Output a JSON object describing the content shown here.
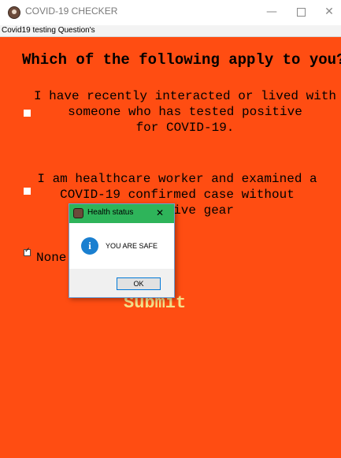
{
  "window": {
    "title": "COVID-19 CHECKER",
    "menu_label": "Covid19 testing Question's",
    "minimize": "—",
    "close": "✕"
  },
  "form": {
    "heading": "Which of the following apply to you?",
    "options": [
      {
        "text": "I have recently interacted or lived with\nsomeone who has tested positive\nfor COVID-19.",
        "checked": false
      },
      {
        "text": "I am healthcare worker and examined a\nCOVID-19 confirmed case without\nprotective gear",
        "checked": false
      },
      {
        "text": "None",
        "checked": true
      }
    ],
    "submit_label": "Submit"
  },
  "dialog": {
    "title": "Health status",
    "close": "✕",
    "message": "YOU ARE SAFE",
    "icon_glyph": "i",
    "ok_label": "OK"
  },
  "colors": {
    "background": "#ff4d12",
    "submit_text": "#f5e08a",
    "dialog_titlebar": "#2eb45a",
    "info_icon": "#1a7fd0"
  }
}
